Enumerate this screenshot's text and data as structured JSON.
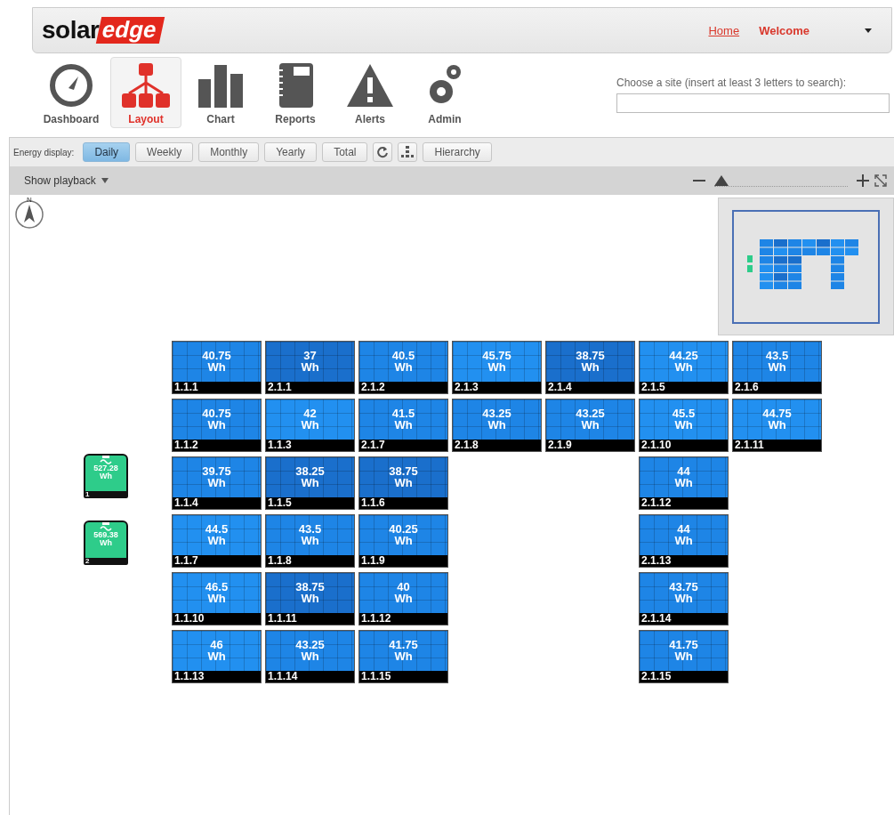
{
  "header": {
    "logo": {
      "part_1": "solar",
      "part_2": "edge"
    },
    "links": [
      {
        "label": "Home",
        "kind": "link"
      },
      {
        "label": "Welcome",
        "kind": "user"
      }
    ]
  },
  "nav": [
    {
      "label": "Dashboard",
      "kind": "gauge",
      "selected": false
    },
    {
      "label": "Layout",
      "kind": "layout",
      "selected": true
    },
    {
      "label": "Chart",
      "kind": "chart",
      "selected": false
    },
    {
      "label": "Reports",
      "kind": "reports",
      "selected": false
    },
    {
      "label": "Alerts",
      "kind": "alerts",
      "selected": false
    },
    {
      "label": "Admin",
      "kind": "admin",
      "selected": false
    }
  ],
  "site_search": {
    "label": "Choose a site (insert at least 3 letters to search):"
  },
  "energy_display": {
    "label": "Energy display:",
    "buttons": [
      {
        "label": "Daily",
        "selected": true
      },
      {
        "label": "Weekly",
        "selected": false
      },
      {
        "label": "Monthly",
        "selected": false
      },
      {
        "label": "Yearly",
        "selected": false
      },
      {
        "label": "Total",
        "selected": false
      }
    ],
    "hierarchy": "Hierarchy"
  },
  "playback": {
    "label": "Show playback",
    "zoom": {
      "level": 0.0
    }
  },
  "compass": {
    "label": "N"
  },
  "inverters": [
    {
      "value": "527.28",
      "unit": "Wh",
      "id": "1"
    },
    {
      "value": "569.38",
      "unit": "Wh",
      "id": "2"
    }
  ],
  "panel_rows": [
    [
      {
        "kind": "panel",
        "value": "40.75",
        "unit": "Wh",
        "id": "1.1.1",
        "color": "#1e85e6"
      },
      {
        "kind": "panel",
        "value": "37",
        "unit": "Wh",
        "id": "2.1.1",
        "color": "#1a6fcc"
      },
      {
        "kind": "panel",
        "value": "40.5",
        "unit": "Wh",
        "id": "2.1.2",
        "color": "#1e85e6"
      },
      {
        "kind": "panel",
        "value": "45.75",
        "unit": "Wh",
        "id": "2.1.3",
        "color": "#2290f0"
      },
      {
        "kind": "panel",
        "value": "38.75",
        "unit": "Wh",
        "id": "2.1.4",
        "color": "#1a6fcc"
      },
      {
        "kind": "panel",
        "value": "44.25",
        "unit": "Wh",
        "id": "2.1.5",
        "color": "#2290f0"
      },
      {
        "kind": "panel",
        "value": "43.5",
        "unit": "Wh",
        "id": "2.1.6",
        "color": "#1e85e6"
      }
    ],
    [
      {
        "kind": "panel",
        "value": "40.75",
        "unit": "Wh",
        "id": "1.1.2",
        "color": "#1e85e6"
      },
      {
        "kind": "panel",
        "value": "42",
        "unit": "Wh",
        "id": "1.1.3",
        "color": "#2290f0"
      },
      {
        "kind": "panel",
        "value": "41.5",
        "unit": "Wh",
        "id": "2.1.7",
        "color": "#1e85e6"
      },
      {
        "kind": "panel",
        "value": "43.25",
        "unit": "Wh",
        "id": "2.1.8",
        "color": "#1e85e6"
      },
      {
        "kind": "panel",
        "value": "43.25",
        "unit": "Wh",
        "id": "2.1.9",
        "color": "#1e85e6"
      },
      {
        "kind": "panel",
        "value": "45.5",
        "unit": "Wh",
        "id": "2.1.10",
        "color": "#2290f0"
      },
      {
        "kind": "panel",
        "value": "44.75",
        "unit": "Wh",
        "id": "2.1.11",
        "color": "#2290f0"
      }
    ],
    [
      {
        "kind": "panel",
        "value": "39.75",
        "unit": "Wh",
        "id": "1.1.4",
        "color": "#1e85e6"
      },
      {
        "kind": "panel",
        "value": "38.25",
        "unit": "Wh",
        "id": "1.1.5",
        "color": "#1a6fcc"
      },
      {
        "kind": "panel",
        "value": "38.75",
        "unit": "Wh",
        "id": "1.1.6",
        "color": "#1a6fcc"
      },
      {
        "kind": "empty"
      },
      {
        "kind": "empty"
      },
      {
        "kind": "panel",
        "value": "44",
        "unit": "Wh",
        "id": "2.1.12",
        "color": "#1e85e6"
      },
      {
        "kind": "empty"
      }
    ],
    [
      {
        "kind": "panel",
        "value": "44.5",
        "unit": "Wh",
        "id": "1.1.7",
        "color": "#2290f0"
      },
      {
        "kind": "panel",
        "value": "43.5",
        "unit": "Wh",
        "id": "1.1.8",
        "color": "#1e85e6"
      },
      {
        "kind": "panel",
        "value": "40.25",
        "unit": "Wh",
        "id": "1.1.9",
        "color": "#1e85e6"
      },
      {
        "kind": "empty"
      },
      {
        "kind": "empty"
      },
      {
        "kind": "panel",
        "value": "44",
        "unit": "Wh",
        "id": "2.1.13",
        "color": "#1e85e6"
      },
      {
        "kind": "empty"
      }
    ],
    [
      {
        "kind": "panel",
        "value": "46.5",
        "unit": "Wh",
        "id": "1.1.10",
        "color": "#2290f0"
      },
      {
        "kind": "panel",
        "value": "38.75",
        "unit": "Wh",
        "id": "1.1.11",
        "color": "#1a6fcc"
      },
      {
        "kind": "panel",
        "value": "40",
        "unit": "Wh",
        "id": "1.1.12",
        "color": "#1e85e6"
      },
      {
        "kind": "empty"
      },
      {
        "kind": "empty"
      },
      {
        "kind": "panel",
        "value": "43.75",
        "unit": "Wh",
        "id": "2.1.14",
        "color": "#1e85e6"
      },
      {
        "kind": "empty"
      }
    ],
    [
      {
        "kind": "panel",
        "value": "46",
        "unit": "Wh",
        "id": "1.1.13",
        "color": "#2290f0"
      },
      {
        "kind": "panel",
        "value": "43.25",
        "unit": "Wh",
        "id": "1.1.14",
        "color": "#1e85e6"
      },
      {
        "kind": "panel",
        "value": "41.75",
        "unit": "Wh",
        "id": "1.1.15",
        "color": "#1e85e6"
      },
      {
        "kind": "empty"
      },
      {
        "kind": "empty"
      },
      {
        "kind": "panel",
        "value": "41.75",
        "unit": "Wh",
        "id": "2.1.15",
        "color": "#1e85e6"
      },
      {
        "kind": "empty"
      }
    ]
  ]
}
